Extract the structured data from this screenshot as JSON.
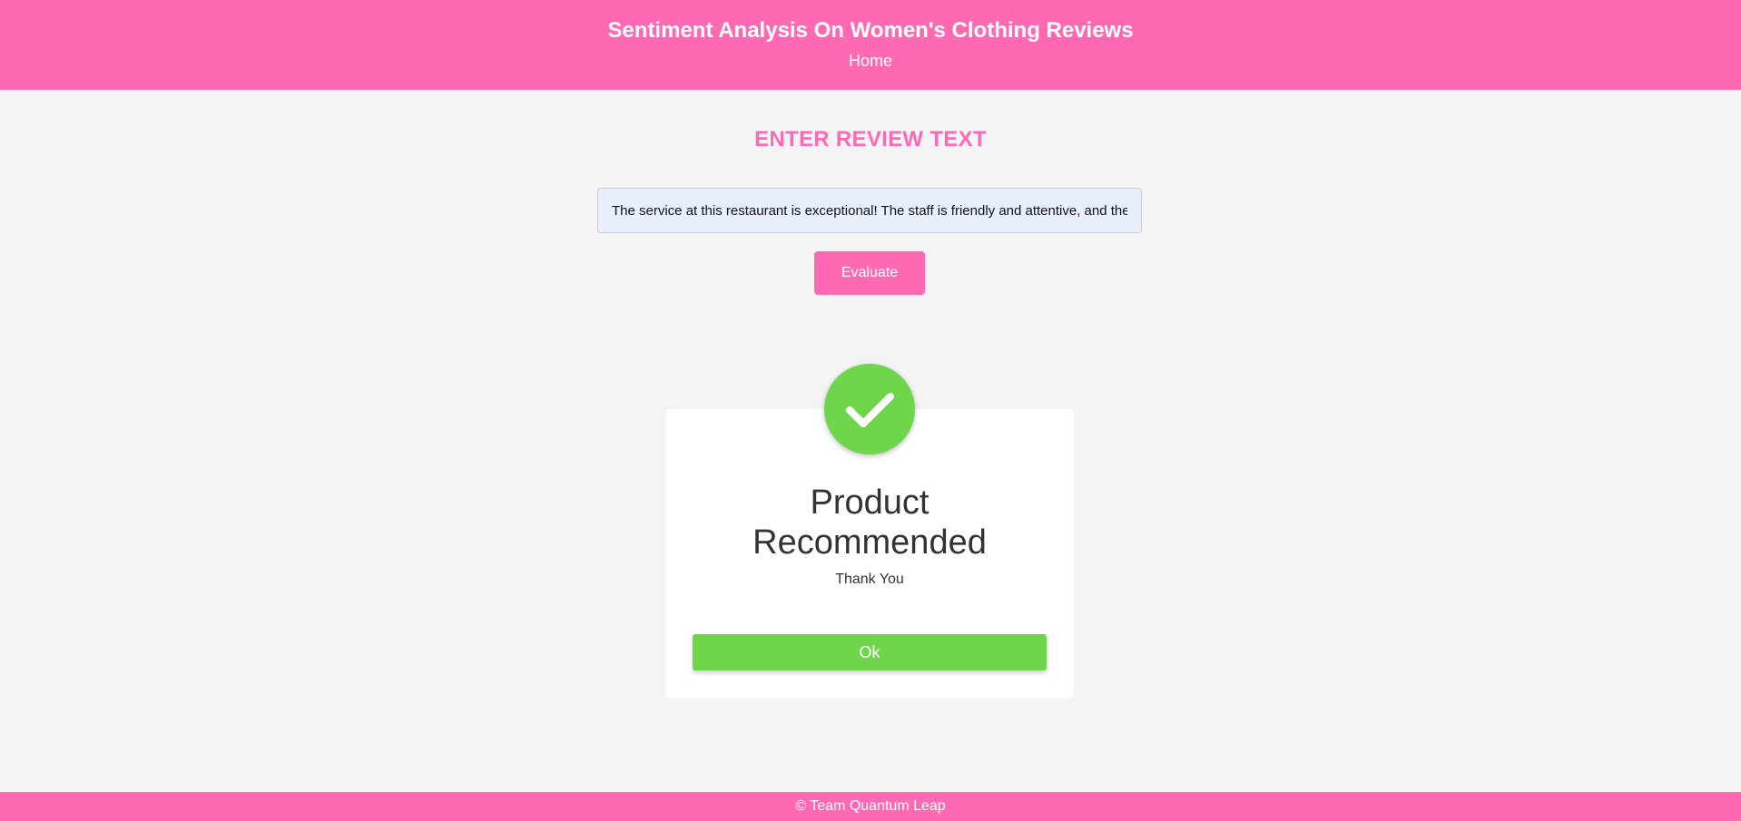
{
  "header": {
    "title": "Sentiment Analysis On Women's Clothing Reviews",
    "nav_home": "Home"
  },
  "main": {
    "heading": "ENTER REVIEW TEXT",
    "review_input": {
      "value": "The service at this restaurant is exceptional! The staff is friendly and attentive, and the food is delicious."
    },
    "evaluate_label": "Evaluate"
  },
  "result_modal": {
    "icon": "check-icon",
    "title_line1": "Product",
    "title_line2": "Recommended",
    "subtitle": "Thank You",
    "ok_label": "Ok"
  },
  "footer": {
    "text": "© Team Quantum Leap"
  },
  "colors": {
    "brand_pink": "#ff69b4",
    "success_green": "#6fd64c",
    "background": "#f4f4f4"
  }
}
